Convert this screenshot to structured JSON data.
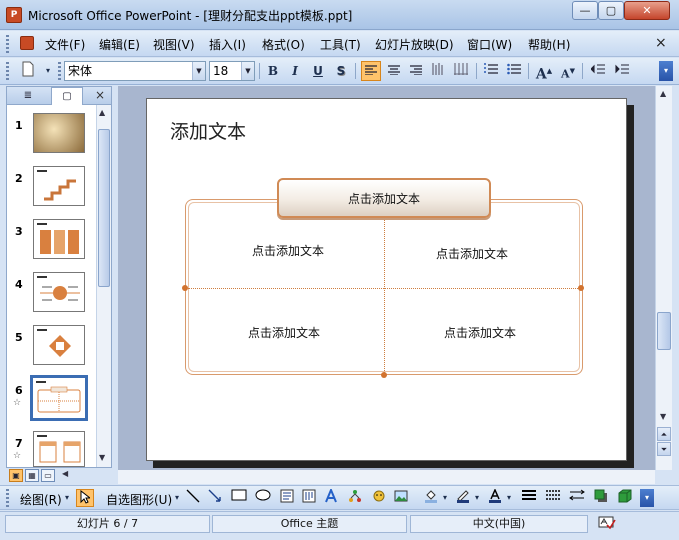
{
  "window": {
    "title": "Microsoft Office PowerPoint - [理财分配支出ppt模板.ppt]",
    "app_icon": "P",
    "minimize": "—",
    "maximize": "▢",
    "close": "✕"
  },
  "menu": {
    "items": [
      "文件(F)",
      "编辑(E)",
      "视图(V)",
      "插入(I)",
      "格式(O)",
      "工具(T)",
      "幻灯片放映(D)",
      "窗口(W)",
      "帮助(H)"
    ],
    "close": "×"
  },
  "toolbar": {
    "font_name": "宋体",
    "font_size": "18",
    "bold": "B",
    "italic": "I",
    "underline": "U",
    "shadow": "S",
    "increase_font": "A",
    "decrease_font": "A"
  },
  "left_pane": {
    "tab_outline_icon": "outline-icon",
    "tab_slides_icon": "slides-icon",
    "close": "×",
    "slides": [
      {
        "number": "1",
        "star": ""
      },
      {
        "number": "2",
        "star": ""
      },
      {
        "number": "3",
        "star": ""
      },
      {
        "number": "4",
        "star": ""
      },
      {
        "number": "5",
        "star": ""
      },
      {
        "number": "6",
        "star": "☆",
        "selected": true
      },
      {
        "number": "7",
        "star": "☆"
      }
    ]
  },
  "slide": {
    "title": "添加文本",
    "header": "点击添加文本",
    "cells": [
      "点击添加文本",
      "点击添加文本",
      "点击添加文本",
      "点击添加文本"
    ]
  },
  "drawbar": {
    "draw_label": "绘图(R)",
    "autoshape_label": "自选图形(U)"
  },
  "status": {
    "slide_counter": "幻灯片 6 / 7",
    "theme": "Office 主题",
    "language": "中文(中国)"
  },
  "colors": {
    "accent_orange": "#d2732f",
    "toolbar_blue": "#c5d8f1",
    "selected_highlight": "#ffc36b"
  }
}
